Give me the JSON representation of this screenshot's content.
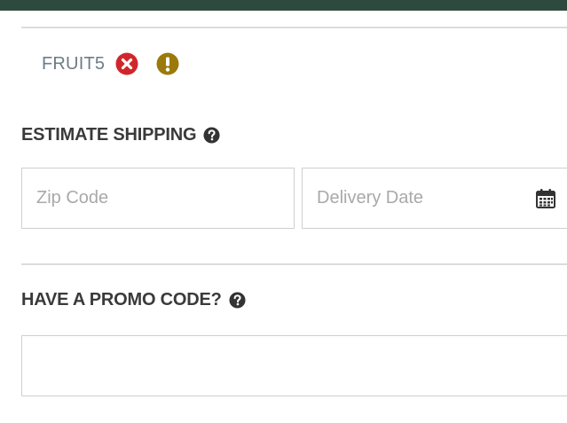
{
  "applied_promo": {
    "code": "FRUIT5",
    "remove_icon": "times-circle-icon",
    "warning_icon": "exclamation-circle-icon",
    "colors": {
      "remove": "#d0262b",
      "warning": "#9c7a0a"
    }
  },
  "estimate_shipping": {
    "title": "ESTIMATE SHIPPING",
    "zip": {
      "placeholder": "Zip Code",
      "value": ""
    },
    "delivery_date": {
      "placeholder": "Delivery Date",
      "value": "",
      "icon": "calendar-icon"
    }
  },
  "promo": {
    "title": "HAVE A PROMO CODE?",
    "input": {
      "placeholder": "",
      "value": ""
    }
  },
  "theme": {
    "topbar": "#2e4a3f",
    "text_muted": "#6d7d86",
    "heading": "#3a3a3a"
  }
}
